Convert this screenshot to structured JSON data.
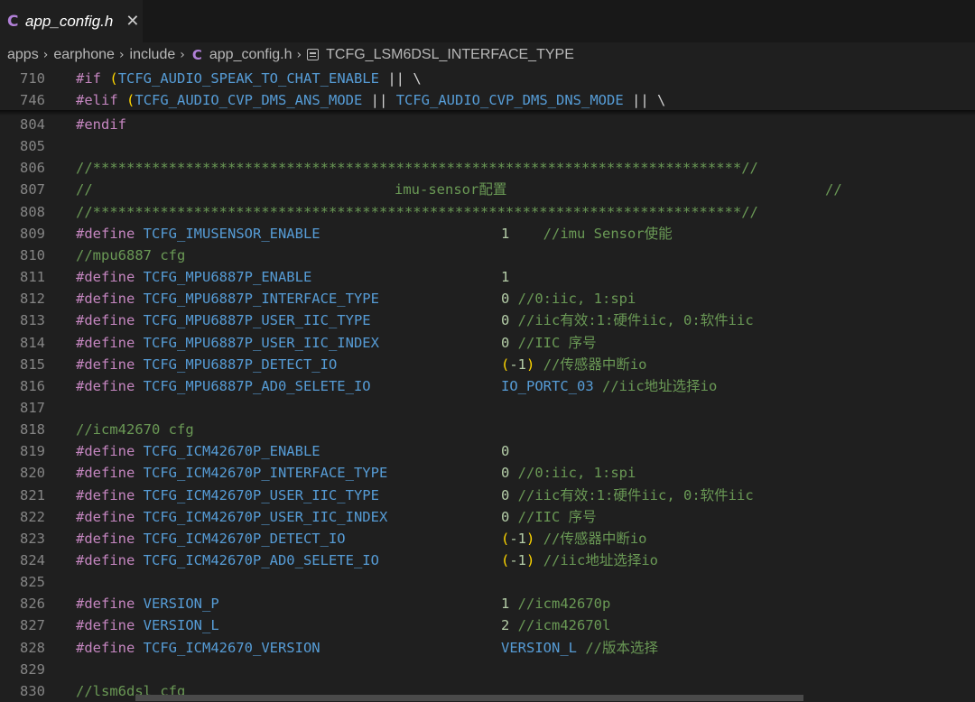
{
  "tab": {
    "icon": "C",
    "name": "app_config.h",
    "close": "✕"
  },
  "breadcrumb": [
    "apps",
    "earphone",
    "include",
    "app_config.h",
    "TCFG_LSM6DSL_INTERFACE_TYPE"
  ],
  "sticky": [
    {
      "ln": "710",
      "text": "#if (TCFG_AUDIO_SPEAK_TO_CHAT_ENABLE || \\"
    },
    {
      "ln": "746",
      "text": "#elif (TCFG_AUDIO_CVP_DMS_ANS_MODE || TCFG_AUDIO_CVP_DMS_DNS_MODE || \\"
    }
  ],
  "lines": [
    {
      "ln": "804",
      "kind": "endif",
      "a": "#endif"
    },
    {
      "ln": "805",
      "kind": "blank"
    },
    {
      "ln": "806",
      "kind": "comment",
      "a": "//*****************************************************************************//"
    },
    {
      "ln": "807",
      "kind": "comment3",
      "a": "//",
      "b": "imu-sensor配置",
      "c": "//"
    },
    {
      "ln": "808",
      "kind": "comment",
      "a": "//*****************************************************************************//"
    },
    {
      "ln": "809",
      "kind": "define",
      "a": "TCFG_IMUSENSOR_ENABLE",
      "v": "1",
      "vclass": "num",
      "c": "    //imu Sensor使能"
    },
    {
      "ln": "810",
      "kind": "comment",
      "a": "//mpu6887 cfg"
    },
    {
      "ln": "811",
      "kind": "define",
      "a": "TCFG_MPU6887P_ENABLE",
      "v": "1",
      "vclass": "num",
      "c": ""
    },
    {
      "ln": "812",
      "kind": "define",
      "a": "TCFG_MPU6887P_INTERFACE_TYPE",
      "v": "0",
      "vclass": "num",
      "c": " //0:iic, 1:spi"
    },
    {
      "ln": "813",
      "kind": "define",
      "a": "TCFG_MPU6887P_USER_IIC_TYPE",
      "v": "0",
      "vclass": "num",
      "c": " //iic有效:1:硬件iic, 0:软件iic"
    },
    {
      "ln": "814",
      "kind": "define",
      "a": "TCFG_MPU6887P_USER_IIC_INDEX",
      "v": "0",
      "vclass": "num",
      "c": " //IIC 序号"
    },
    {
      "ln": "815",
      "kind": "defineparen",
      "a": "TCFG_MPU6887P_DETECT_IO",
      "v": "-1",
      "c": " //传感器中断io"
    },
    {
      "ln": "816",
      "kind": "define",
      "a": "TCFG_MPU6887P_AD0_SELETE_IO",
      "v": "IO_PORTC_03",
      "vclass": "mac",
      "c": " //iic地址选择io"
    },
    {
      "ln": "817",
      "kind": "blank"
    },
    {
      "ln": "818",
      "kind": "comment",
      "a": "//icm42670 cfg"
    },
    {
      "ln": "819",
      "kind": "define",
      "a": "TCFG_ICM42670P_ENABLE",
      "v": "0",
      "vclass": "num",
      "c": ""
    },
    {
      "ln": "820",
      "kind": "define",
      "a": "TCFG_ICM42670P_INTERFACE_TYPE",
      "v": "0",
      "vclass": "num",
      "c": " //0:iic, 1:spi"
    },
    {
      "ln": "821",
      "kind": "define",
      "a": "TCFG_ICM42670P_USER_IIC_TYPE",
      "v": "0",
      "vclass": "num",
      "c": " //iic有效:1:硬件iic, 0:软件iic"
    },
    {
      "ln": "822",
      "kind": "define",
      "a": "TCFG_ICM42670P_USER_IIC_INDEX",
      "v": "0",
      "vclass": "num",
      "c": " //IIC 序号"
    },
    {
      "ln": "823",
      "kind": "defineparen",
      "a": "TCFG_ICM42670P_DETECT_IO",
      "v": "-1",
      "c": " //传感器中断io"
    },
    {
      "ln": "824",
      "kind": "defineparen",
      "a": "TCFG_ICM42670P_AD0_SELETE_IO",
      "v": "-1",
      "c": " //iic地址选择io"
    },
    {
      "ln": "825",
      "kind": "blank"
    },
    {
      "ln": "826",
      "kind": "define",
      "a": "VERSION_P",
      "v": "1",
      "vclass": "num",
      "c": " //icm42670p"
    },
    {
      "ln": "827",
      "kind": "define",
      "a": "VERSION_L",
      "v": "2",
      "vclass": "num",
      "c": " //icm42670l"
    },
    {
      "ln": "828",
      "kind": "define",
      "a": "TCFG_ICM42670_VERSION",
      "v": "VERSION_L",
      "vclass": "mac",
      "c": " //版本选择"
    },
    {
      "ln": "829",
      "kind": "blank"
    },
    {
      "ln": "830",
      "kind": "comment",
      "a": "//lsm6dsl cfg"
    }
  ],
  "keywords": {
    "define": "#define"
  },
  "colors": {
    "keyword": "#c586c0",
    "macro": "#569cd6",
    "number": "#b5cea8",
    "comment": "#6a9955",
    "paren": "#ffd700",
    "background": "#1f1f1f"
  }
}
